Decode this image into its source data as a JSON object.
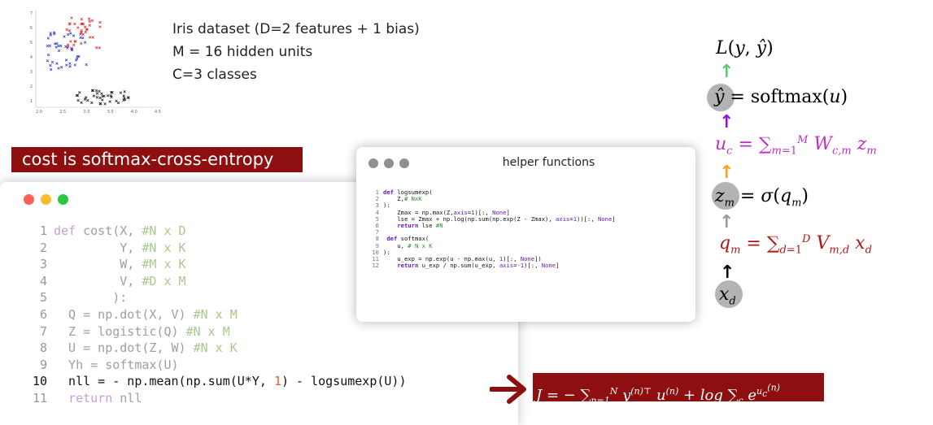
{
  "iris_info": {
    "line1": "Iris dataset (D=2 features + 1 bias)",
    "line2": "M = 16 hidden units",
    "line3": "C=3 classes"
  },
  "cost_banner": "cost is softmax-cross-entropy",
  "scatter_plot": {
    "x_ticks": [
      "2.0",
      "2.5",
      "3.0",
      "3.5",
      "4.0",
      "4.5"
    ],
    "y_ticks": [
      "1",
      "2",
      "3",
      "4",
      "5",
      "6",
      "7"
    ],
    "colors": {
      "class_red": "#e03030",
      "class_blue": "#3040d0",
      "class_black": "#222222"
    }
  },
  "main_code": {
    "lines": [
      {
        "n": "1",
        "text": "def cost(X, #N x D"
      },
      {
        "n": "2",
        "text": "         Y, #N x K"
      },
      {
        "n": "3",
        "text": "         W, #M x K"
      },
      {
        "n": "4",
        "text": "         V, #D x M"
      },
      {
        "n": "5",
        "text": "        ):"
      },
      {
        "n": "6",
        "text": "  Q = np.dot(X, V) #N x M"
      },
      {
        "n": "7",
        "text": "  Z = logistic(Q) #N x M"
      },
      {
        "n": "8",
        "text": "  U = np.dot(Z, W) #N x K"
      },
      {
        "n": "9",
        "text": "  Yh = softmax(U)"
      },
      {
        "n": "10",
        "text": "  nll = - np.mean(np.sum(U*Y, 1) - logsumexp(U))"
      },
      {
        "n": "11",
        "text": "  return nll"
      }
    ]
  },
  "helper_window": {
    "title": "helper functions",
    "lines": [
      {
        "n": "1",
        "text": "def logsumexp("
      },
      {
        "n": "2",
        "text": "    Z,# NxK"
      },
      {
        "n": "3",
        "text": "):"
      },
      {
        "n": "4",
        "text": "    Zmax = np.max(Z,axis=1)[:, None]"
      },
      {
        "n": "5",
        "text": "    lse = Zmax + np.log(np.sum(np.exp(Z - Zmax), axis=1))[:, None]"
      },
      {
        "n": "6",
        "text": "    return lse #N"
      },
      {
        "n": "7",
        "text": ""
      },
      {
        "n": "8",
        "text": " def softmax("
      },
      {
        "n": "9",
        "text": "    u, # N x K"
      },
      {
        "n": "10",
        "text": "):"
      },
      {
        "n": "11",
        "text": "    u_exp = np.exp(u - np.max(u, 1)[:, None])"
      },
      {
        "n": "12",
        "text": "    return u_exp / np.sum(u_exp, axis=-1)[:, None]"
      }
    ]
  },
  "loss_formula": "J = − ∑ y(n)ᵀ u(n) + log ∑ e^u",
  "diagram": {
    "loss": "L(y, ŷ)",
    "yhat_eq": "= softmax(u)",
    "u_eq": "u_c = ∑ W_{c,m} z_m",
    "z_eq": "= σ(q_m)",
    "q_eq": "q_m = ∑ V_{m,d} x_d",
    "colors": {
      "green": "#5cc87a",
      "purple": "#9b10e0",
      "orange": "#f5a020",
      "gray": "#9a9a9a",
      "black": "#000000",
      "magenta": "#c030c0",
      "crimson": "#b01818"
    }
  }
}
